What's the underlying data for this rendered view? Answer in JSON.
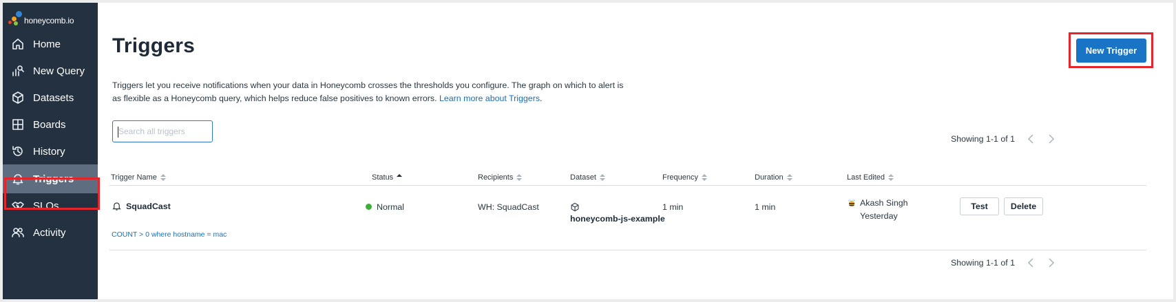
{
  "brand": {
    "logo_text": "honeycomb.io"
  },
  "sidebar": {
    "items": [
      {
        "label": "Home",
        "icon": "home-icon"
      },
      {
        "label": "New Query",
        "icon": "query-icon"
      },
      {
        "label": "Datasets",
        "icon": "cube-icon"
      },
      {
        "label": "Boards",
        "icon": "boards-icon"
      },
      {
        "label": "History",
        "icon": "history-icon"
      },
      {
        "label": "Triggers",
        "icon": "bell-icon",
        "active": true
      },
      {
        "label": "SLOs",
        "icon": "handshake-icon"
      },
      {
        "label": "Activity",
        "icon": "people-icon"
      }
    ]
  },
  "page": {
    "title": "Triggers",
    "intro_line1": "Triggers let you receive notifications when your data in Honeycomb crosses the thresholds you configure. The graph on which to alert is",
    "intro_line2": "as flexible as a Honeycomb query, which helps reduce false positives to known errors.",
    "intro_link": "Learn more about Triggers",
    "intro_period": ".",
    "new_button": "New Trigger"
  },
  "search": {
    "placeholder": "Search all triggers",
    "value": ""
  },
  "pagination": {
    "top": "Showing 1-1 of 1",
    "bottom": "Showing 1-1 of 1"
  },
  "table": {
    "columns": [
      "Trigger Name",
      "Status",
      "Recipients",
      "Dataset",
      "Frequency",
      "Duration",
      "Last Edited"
    ],
    "sorted_column": "Status",
    "rows": [
      {
        "name": "SquadCast",
        "query": "COUNT > 0 where hostname = mac",
        "status": "Normal",
        "recipients": "WH: SquadCast",
        "dataset": "honeycomb-js-example",
        "frequency": "1 min",
        "duration": "1 min",
        "edited_by": "Akash Singh",
        "edited_when": "Yesterday",
        "test_label": "Test",
        "delete_label": "Delete"
      }
    ]
  },
  "colors": {
    "sidebar_bg": "#243140",
    "active_bg": "#5e6e80",
    "primary": "#1a74c6",
    "status_normal": "#3fae3a",
    "highlight": "#e3262b"
  }
}
